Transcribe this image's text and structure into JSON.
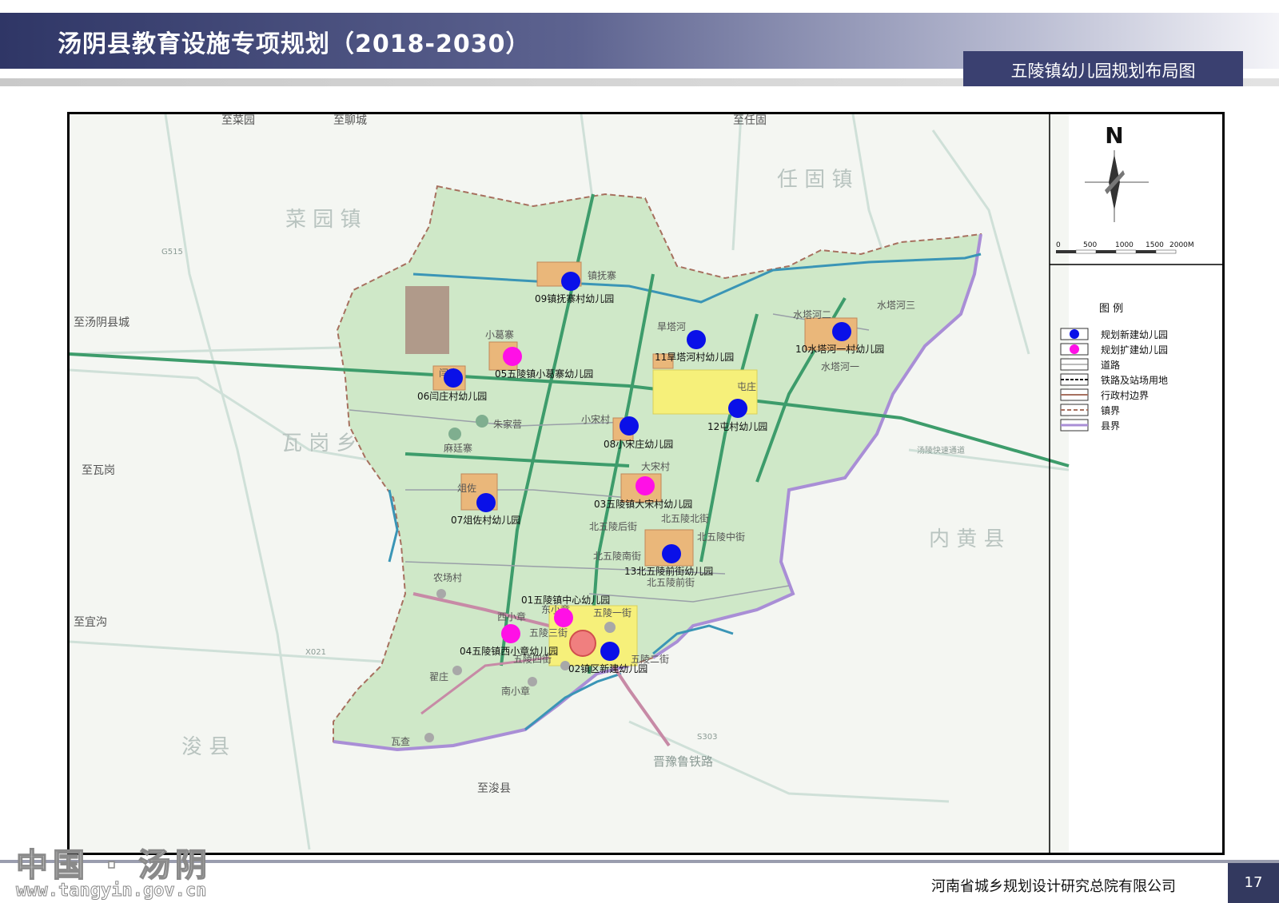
{
  "header": {
    "title": "汤阴县教育设施专项规划（2018-2030）",
    "subtitle": "五陵镇幼儿园规划布局图"
  },
  "footer": {
    "company": "河南省城乡规划设计研究总院有限公司",
    "page_number": "17"
  },
  "watermark": {
    "text": "中国 · 汤阴",
    "url": "www.tangyin.gov.cn"
  },
  "colors": {
    "new_kindergarten": "#0a10e8",
    "expand_kindergarten": "#ff10e6",
    "town_area": "#cfe8c8",
    "village_area": "#eab77a",
    "boundary": "#a7705f",
    "county_boundary": "#a98ed6",
    "river": "#3a95b6"
  },
  "map": {
    "directions": {
      "laiyuan": "至菜园",
      "liaocheng": "至聊城",
      "rengu": "至任固",
      "tangyin_city": "至汤阴县城",
      "wagang": "至瓦岗",
      "yigou": "至宜沟",
      "junxian": "至浚县"
    },
    "regions": {
      "laiyuan_town": "菜 园 镇",
      "rengu_town": "任 固 镇",
      "wagang_xiang": "瓦 岗 乡",
      "neihuang_county": "内 黄 县",
      "jun_county": "浚 县"
    },
    "road_labels": {
      "g515": "G515",
      "s303": "S303",
      "x021": "X021",
      "railway": "晋豫鲁铁路",
      "expressway": "汤陵快速通道"
    },
    "villages": [
      {
        "name": "镇抚寨"
      },
      {
        "name": "小葛寨"
      },
      {
        "name": "闫庄"
      },
      {
        "name": "朱家营"
      },
      {
        "name": "麻廷寨"
      },
      {
        "name": "小宋村"
      },
      {
        "name": "旱塔河"
      },
      {
        "name": "屯庄"
      },
      {
        "name": "水塔河二"
      },
      {
        "name": "水塔河三"
      },
      {
        "name": "水塔河一"
      },
      {
        "name": "大宋村"
      },
      {
        "name": "俎佐"
      },
      {
        "name": "北五陵北街"
      },
      {
        "name": "北五陵后街"
      },
      {
        "name": "北五陵中街"
      },
      {
        "name": "北五陵南街"
      },
      {
        "name": "北五陵前街"
      },
      {
        "name": "农场村"
      },
      {
        "name": "西小章"
      },
      {
        "name": "东小章"
      },
      {
        "name": "五陵一街"
      },
      {
        "name": "五陵二街"
      },
      {
        "name": "五陵三街"
      },
      {
        "name": "五陵四街"
      },
      {
        "name": "翟庄"
      },
      {
        "name": "南小章"
      },
      {
        "name": "瓦查"
      }
    ],
    "kindergartens": [
      {
        "label": "01五陵镇中心幼儿园",
        "type": "expand"
      },
      {
        "label": "02镇区新建幼儿园",
        "type": "new"
      },
      {
        "label": "03五陵镇大宋村幼儿园",
        "type": "expand"
      },
      {
        "label": "04五陵镇西小章幼儿园",
        "type": "expand"
      },
      {
        "label": "05五陵镇小葛寨幼儿园",
        "type": "expand"
      },
      {
        "label": "06闫庄村幼儿园",
        "type": "new"
      },
      {
        "label": "07俎佐村幼儿园",
        "type": "new"
      },
      {
        "label": "08小宋庄幼儿园",
        "type": "new"
      },
      {
        "label": "09镇抚寨村幼儿园",
        "type": "new"
      },
      {
        "label": "10水塔河一村幼儿园",
        "type": "new"
      },
      {
        "label": "11旱塔河村幼儿园",
        "type": "new"
      },
      {
        "label": "12屯村幼儿园",
        "type": "new"
      },
      {
        "label": "13北五陵前街幼儿园",
        "type": "new"
      }
    ]
  },
  "compass": {
    "north": "N",
    "scale_labels": [
      "0",
      "500",
      "1000",
      "1500",
      "2000M"
    ]
  },
  "legend": {
    "title": "图  例",
    "items": [
      {
        "label": "规划新建幼儿园",
        "symbol": "new"
      },
      {
        "label": "规划扩建幼儿园",
        "symbol": "expand"
      },
      {
        "label": "道路",
        "symbol": "road"
      },
      {
        "label": "铁路及站场用地",
        "symbol": "railway"
      },
      {
        "label": "行政村边界",
        "symbol": "village-boundary"
      },
      {
        "label": "镇界",
        "symbol": "town-boundary"
      },
      {
        "label": "县界",
        "symbol": "county-boundary"
      }
    ]
  }
}
